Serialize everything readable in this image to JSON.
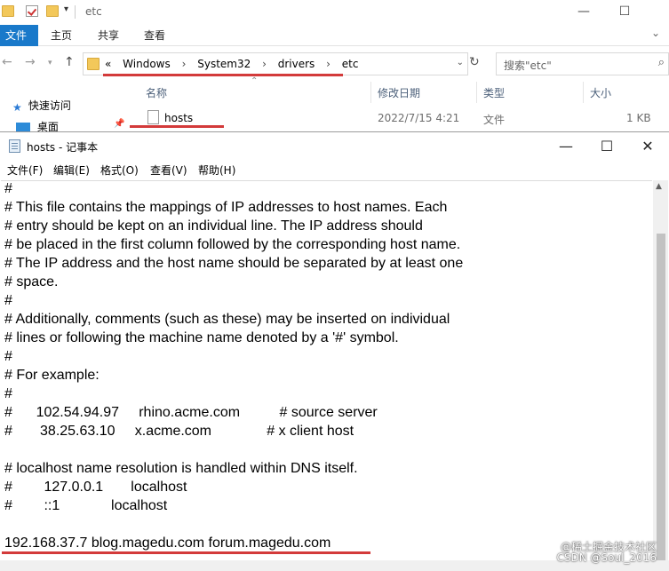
{
  "explorer": {
    "window_title": "etc",
    "window_controls": {
      "minimize": "—",
      "maximize": "☐",
      "close": "✕"
    },
    "ribbon_tabs": [
      "文件",
      "主页",
      "共享",
      "查看"
    ],
    "ribbon_expand": "⌄",
    "address_breadcrumb": [
      "«",
      "Windows",
      "System32",
      "drivers",
      "etc"
    ],
    "search_placeholder": "搜索\"etc\"",
    "columns": {
      "name": "名称",
      "modified": "修改日期",
      "type": "类型",
      "size": "大小"
    },
    "nav_pane": {
      "quick_access": "快速访问",
      "desktop": "桌面"
    },
    "file": {
      "name": "hosts",
      "modified": "2022/7/15 4:21",
      "type": "文件",
      "size": "1 KB"
    },
    "accent_color": "#1979ca",
    "highlight_color": "#d33a3a"
  },
  "notepad": {
    "title": "hosts - 记事本",
    "window_controls": {
      "minimize": "—",
      "maximize": "☐",
      "close": "✕"
    },
    "menu": [
      "文件(F)",
      "编辑(E)",
      "格式(O)",
      "查看(V)",
      "帮助(H)"
    ],
    "lines": [
      "#",
      "# This file contains the mappings of IP addresses to host names. Each",
      "# entry should be kept on an individual line. The IP address should",
      "# be placed in the first column followed by the corresponding host name.",
      "# The IP address and the host name should be separated by at least one",
      "# space.",
      "#",
      "# Additionally, comments (such as these) may be inserted on individual",
      "# lines or following the machine name denoted by a '#' symbol.",
      "#",
      "# For example:",
      "#",
      "#      102.54.94.97     rhino.acme.com          # source server",
      "#       38.25.63.10     x.acme.com              # x client host",
      "",
      "# localhost name resolution is handled within DNS itself.",
      "#\t127.0.0.1       localhost",
      "#\t::1             localhost",
      "",
      "192.168.37.7 blog.magedu.com forum.magedu.com"
    ]
  },
  "watermark": {
    "line1": "@稀土掘金技术社区",
    "line2": "CSDN @Soul_2016"
  }
}
